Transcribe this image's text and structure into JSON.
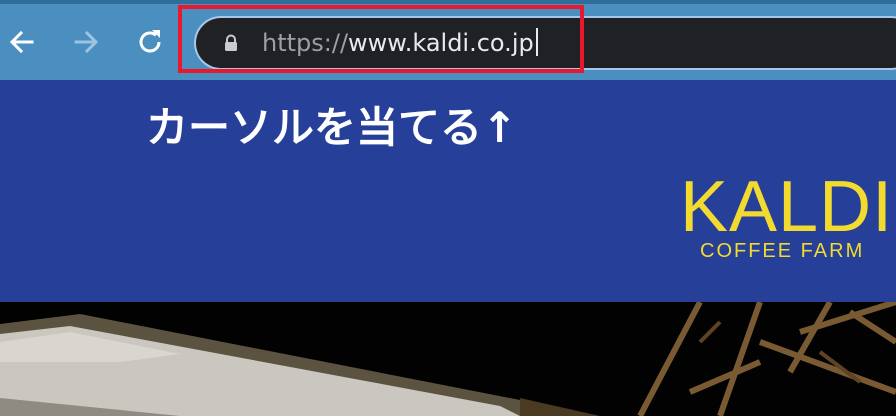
{
  "browser": {
    "nav": {
      "back_icon": "arrow-left-icon",
      "forward_icon": "arrow-right-icon",
      "reload_icon": "reload-icon"
    },
    "address_bar": {
      "lock_icon": "lock-icon",
      "scheme": "https://",
      "host": "www.kaldi.co.jp"
    }
  },
  "annotation": {
    "text": "カーソルを当てる↑",
    "highlight_color": "#e8192c"
  },
  "site": {
    "banner_color": "#26409a",
    "logo": {
      "main": "KALDI",
      "sub": "COFFEE FARM",
      "color": "#f2da2f"
    }
  }
}
